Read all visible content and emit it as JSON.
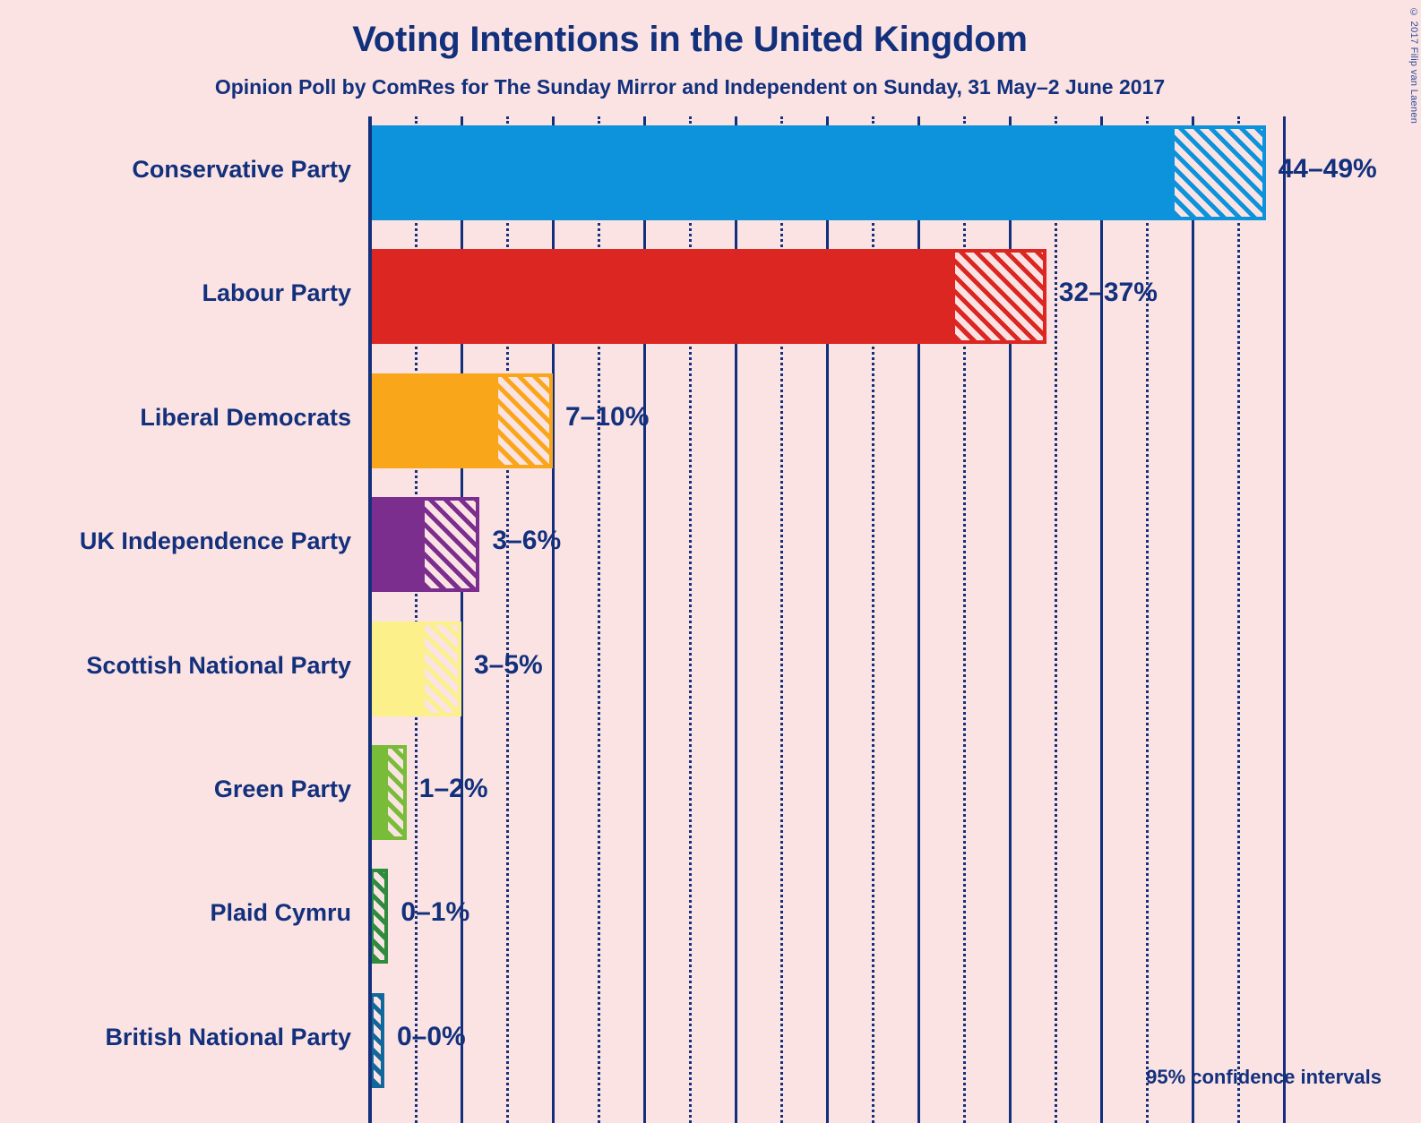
{
  "title": "Voting Intentions in the United Kingdom",
  "subtitle": "Opinion Poll by ComRes for The Sunday Mirror and Independent on Sunday, 31 May–2 June 2017",
  "copyright": "© 2017 Filip van Laenen",
  "legend": "95% confidence intervals",
  "colors": {
    "background": "#fbe3e4",
    "text": "#12307c",
    "gridline": "#12307c"
  },
  "chart_data": {
    "type": "bar",
    "title": "Voting Intentions in the United Kingdom",
    "subtitle": "Opinion Poll by ComRes for The Sunday Mirror and Independent on Sunday, 31 May–2 June 2017",
    "xlabel": "",
    "ylabel": "",
    "xlim": [
      0,
      50
    ],
    "grid": true,
    "grid_major_step": 5,
    "grid_minor_step": 2.5,
    "legend_note": "95% confidence intervals",
    "orientation": "horizontal",
    "categories": [
      "Conservative Party",
      "Labour Party",
      "Liberal Democrats",
      "UK Independence Party",
      "Scottish National Party",
      "Green Party",
      "Plaid Cymru",
      "British National Party"
    ],
    "series": [
      {
        "name": "Confidence interval lower bound (%)",
        "values": [
          44,
          32,
          7,
          3,
          3,
          1,
          0,
          0
        ]
      },
      {
        "name": "Confidence interval upper bound (%)",
        "values": [
          49,
          37,
          10,
          6,
          5,
          2,
          1,
          0
        ]
      }
    ],
    "bars": [
      {
        "label": "Conservative Party",
        "low": 44,
        "high": 49,
        "value_label": "44–49%",
        "color": "#0d93db"
      },
      {
        "label": "Labour Party",
        "low": 32,
        "high": 37,
        "value_label": "32–37%",
        "color": "#dc2622"
      },
      {
        "label": "Liberal Democrats",
        "low": 7,
        "high": 10,
        "value_label": "7–10%",
        "color": "#faa61a"
      },
      {
        "label": "UK Independence Party",
        "low": 3,
        "high": 6,
        "value_label": "3–6%",
        "color": "#7b2e8e"
      },
      {
        "label": "Scottish National Party",
        "low": 3,
        "high": 5,
        "value_label": "3–5%",
        "color": "#fbf08a"
      },
      {
        "label": "Green Party",
        "low": 1,
        "high": 2,
        "value_label": "1–2%",
        "color": "#78bc39"
      },
      {
        "label": "Plaid Cymru",
        "low": 0,
        "high": 1,
        "value_label": "0–1%",
        "color": "#2f8c3f"
      },
      {
        "label": "British National Party",
        "low": 0,
        "high": 0,
        "value_label": "0–0%",
        "color": "#14679a"
      }
    ]
  }
}
